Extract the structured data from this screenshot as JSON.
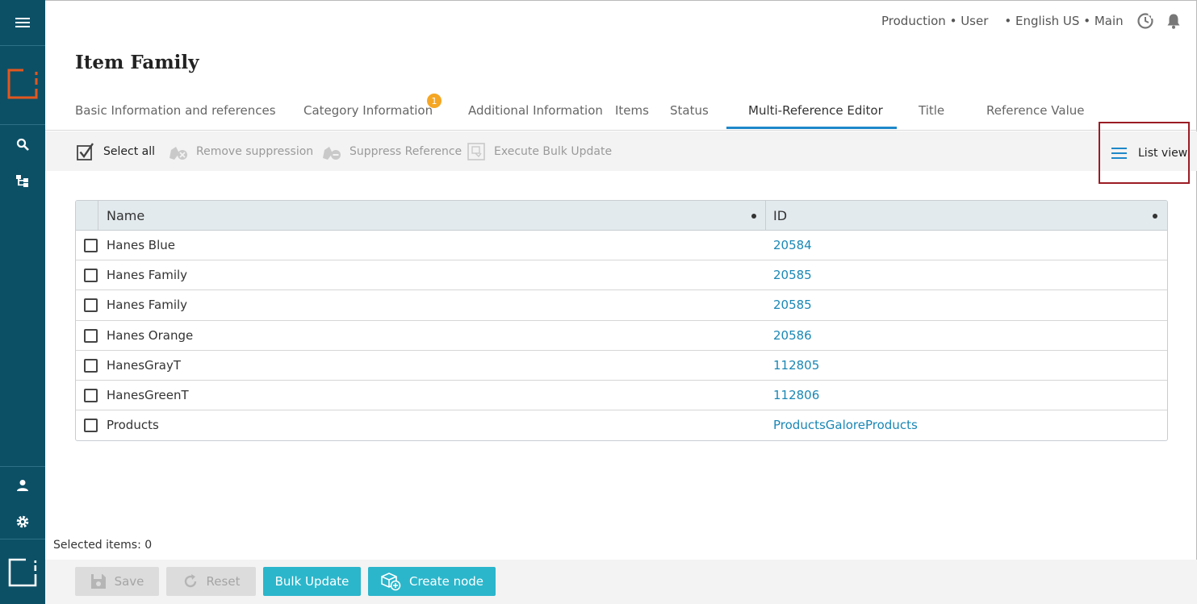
{
  "app": {
    "accent_color": "#1e88c9",
    "rail_color": "#0c5066",
    "logo_color": "#e3571f"
  },
  "rail": {
    "menu_icon": "hamburger-icon",
    "logo_icon": "logo-icon",
    "search_icon": "search-icon",
    "tree_icon": "hierarchy-icon",
    "user_icon": "user-icon",
    "settings_icon": "gear-icon",
    "bottom_icon": "square-logo-icon"
  },
  "header": {
    "context_left": "Production • User",
    "context_right": "• English US • Main",
    "history_icon": "history-icon",
    "notifications_icon": "bell-icon"
  },
  "page": {
    "title": "Item Family"
  },
  "tabs": [
    {
      "label": "Basic Information and references"
    },
    {
      "label": "Category Information",
      "badge": "1"
    },
    {
      "label": "Additional Information"
    },
    {
      "label": "Items"
    },
    {
      "label": "Status"
    },
    {
      "label": "Multi-Reference Editor",
      "active": true
    },
    {
      "label": "Title"
    },
    {
      "label": "Reference Value"
    }
  ],
  "toolbar": {
    "select_all": "Select all",
    "remove_suppression": "Remove suppression",
    "suppress_reference": "Suppress Reference",
    "execute_bulk_update": "Execute Bulk Update",
    "list_view": "List view"
  },
  "table": {
    "columns": [
      "Name",
      "ID"
    ],
    "rows": [
      {
        "name": "Hanes Blue",
        "id": "20584",
        "checked": false
      },
      {
        "name": "Hanes Family",
        "id": "20585",
        "checked": false
      },
      {
        "name": "Hanes Family",
        "id": "20585",
        "checked": false
      },
      {
        "name": "Hanes Orange",
        "id": "20586",
        "checked": false
      },
      {
        "name": "HanesGrayT",
        "id": "112805",
        "checked": false
      },
      {
        "name": "HanesGreenT",
        "id": "112806",
        "checked": false
      },
      {
        "name": "Products",
        "id": "ProductsGaloreProducts",
        "checked": false
      }
    ]
  },
  "status": {
    "selected_items": "Selected items: 0"
  },
  "footer": {
    "save": "Save",
    "reset": "Reset",
    "bulk_update": "Bulk Update",
    "create_node": "Create node"
  }
}
